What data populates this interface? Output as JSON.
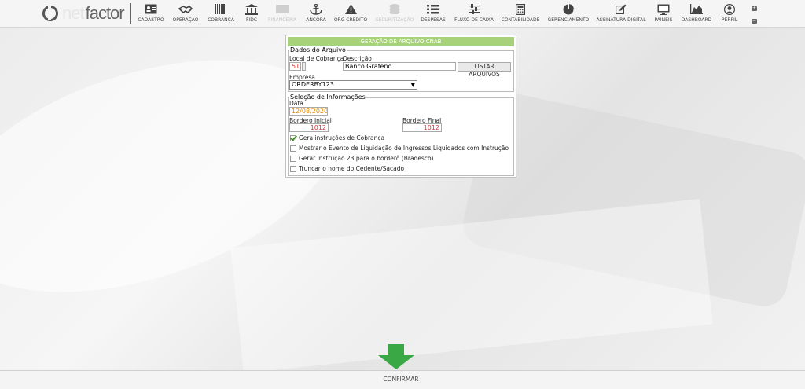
{
  "logo": {
    "part1": "net",
    "part2": "factor"
  },
  "nav": [
    {
      "label": "CADASTRO",
      "icon": "id-card-icon",
      "enabled": true
    },
    {
      "label": "OPERAÇÃO",
      "icon": "handshake-icon",
      "enabled": true
    },
    {
      "label": "COBRANÇA",
      "icon": "barcode-icon",
      "enabled": true
    },
    {
      "label": "FIDC",
      "icon": "bank-icon",
      "enabled": true
    },
    {
      "label": "FINANCEIRA",
      "icon": "money-icon",
      "enabled": false
    },
    {
      "label": "ÂNCORA",
      "icon": "anchor-icon",
      "enabled": true
    },
    {
      "label": "ÓRG CRÉDITO",
      "icon": "warning-icon",
      "enabled": true
    },
    {
      "label": "SECURITIZAÇÃO",
      "icon": "coins-icon",
      "enabled": false
    },
    {
      "label": "DESPESAS",
      "icon": "list-icon",
      "enabled": true
    },
    {
      "label": "FLUXO DE CAIXA",
      "icon": "sliders-icon",
      "enabled": true
    },
    {
      "label": "CONTABILIDADE",
      "icon": "calculator-icon",
      "enabled": true
    },
    {
      "label": "GERENCIAMENTO",
      "icon": "pie-chart-icon",
      "enabled": true
    },
    {
      "label": "ASSINATURA DIGITAL",
      "icon": "edit-icon",
      "enabled": true
    },
    {
      "label": "PAINEIS",
      "icon": "monitor-icon",
      "enabled": true
    },
    {
      "label": "DASHBOARD",
      "icon": "area-chart-icon",
      "enabled": true
    },
    {
      "label": "PERFIL",
      "icon": "user-icon",
      "enabled": true
    }
  ],
  "panel": {
    "title": "GERAÇÃO DE ARQUIVO CNAB",
    "dados": {
      "legend": "Dados do Arquivo",
      "local_label": "Local de Cobrança",
      "local_value": "51",
      "descricao_label": "Descrição",
      "descricao_value": "Banco Grafeno",
      "listar_button": "LISTAR ARQUIVOS",
      "empresa_label": "Empresa",
      "empresa_value": "ORDERBY123"
    },
    "selecao": {
      "legend": "Seleção de Informações",
      "data_label": "Data",
      "data_value": "12/08/2020",
      "bordero_inicial_label": "Bordero Inicial",
      "bordero_inicial_value": "1012",
      "bordero_final_label": "Bordero Final",
      "bordero_final_value": "1012",
      "checks": [
        {
          "label": "Gera instruções de Cobrança",
          "checked": true
        },
        {
          "label": "Mostrar o Evento de Liquidação de Ingressos Liquidados com Instrução",
          "checked": false
        },
        {
          "label": "Gerar Instrução 23 para o borderô (Bradesco)",
          "checked": false
        },
        {
          "label": "Truncar o nome do Cedente/Sacado",
          "checked": false
        }
      ]
    }
  },
  "footer": {
    "confirm_label": "CONFIRMAR"
  },
  "colors": {
    "header_green": "#a8d27a",
    "arrow_green": "#3aa845",
    "value_red": "#dd3333",
    "date_orange": "#e08a00"
  }
}
